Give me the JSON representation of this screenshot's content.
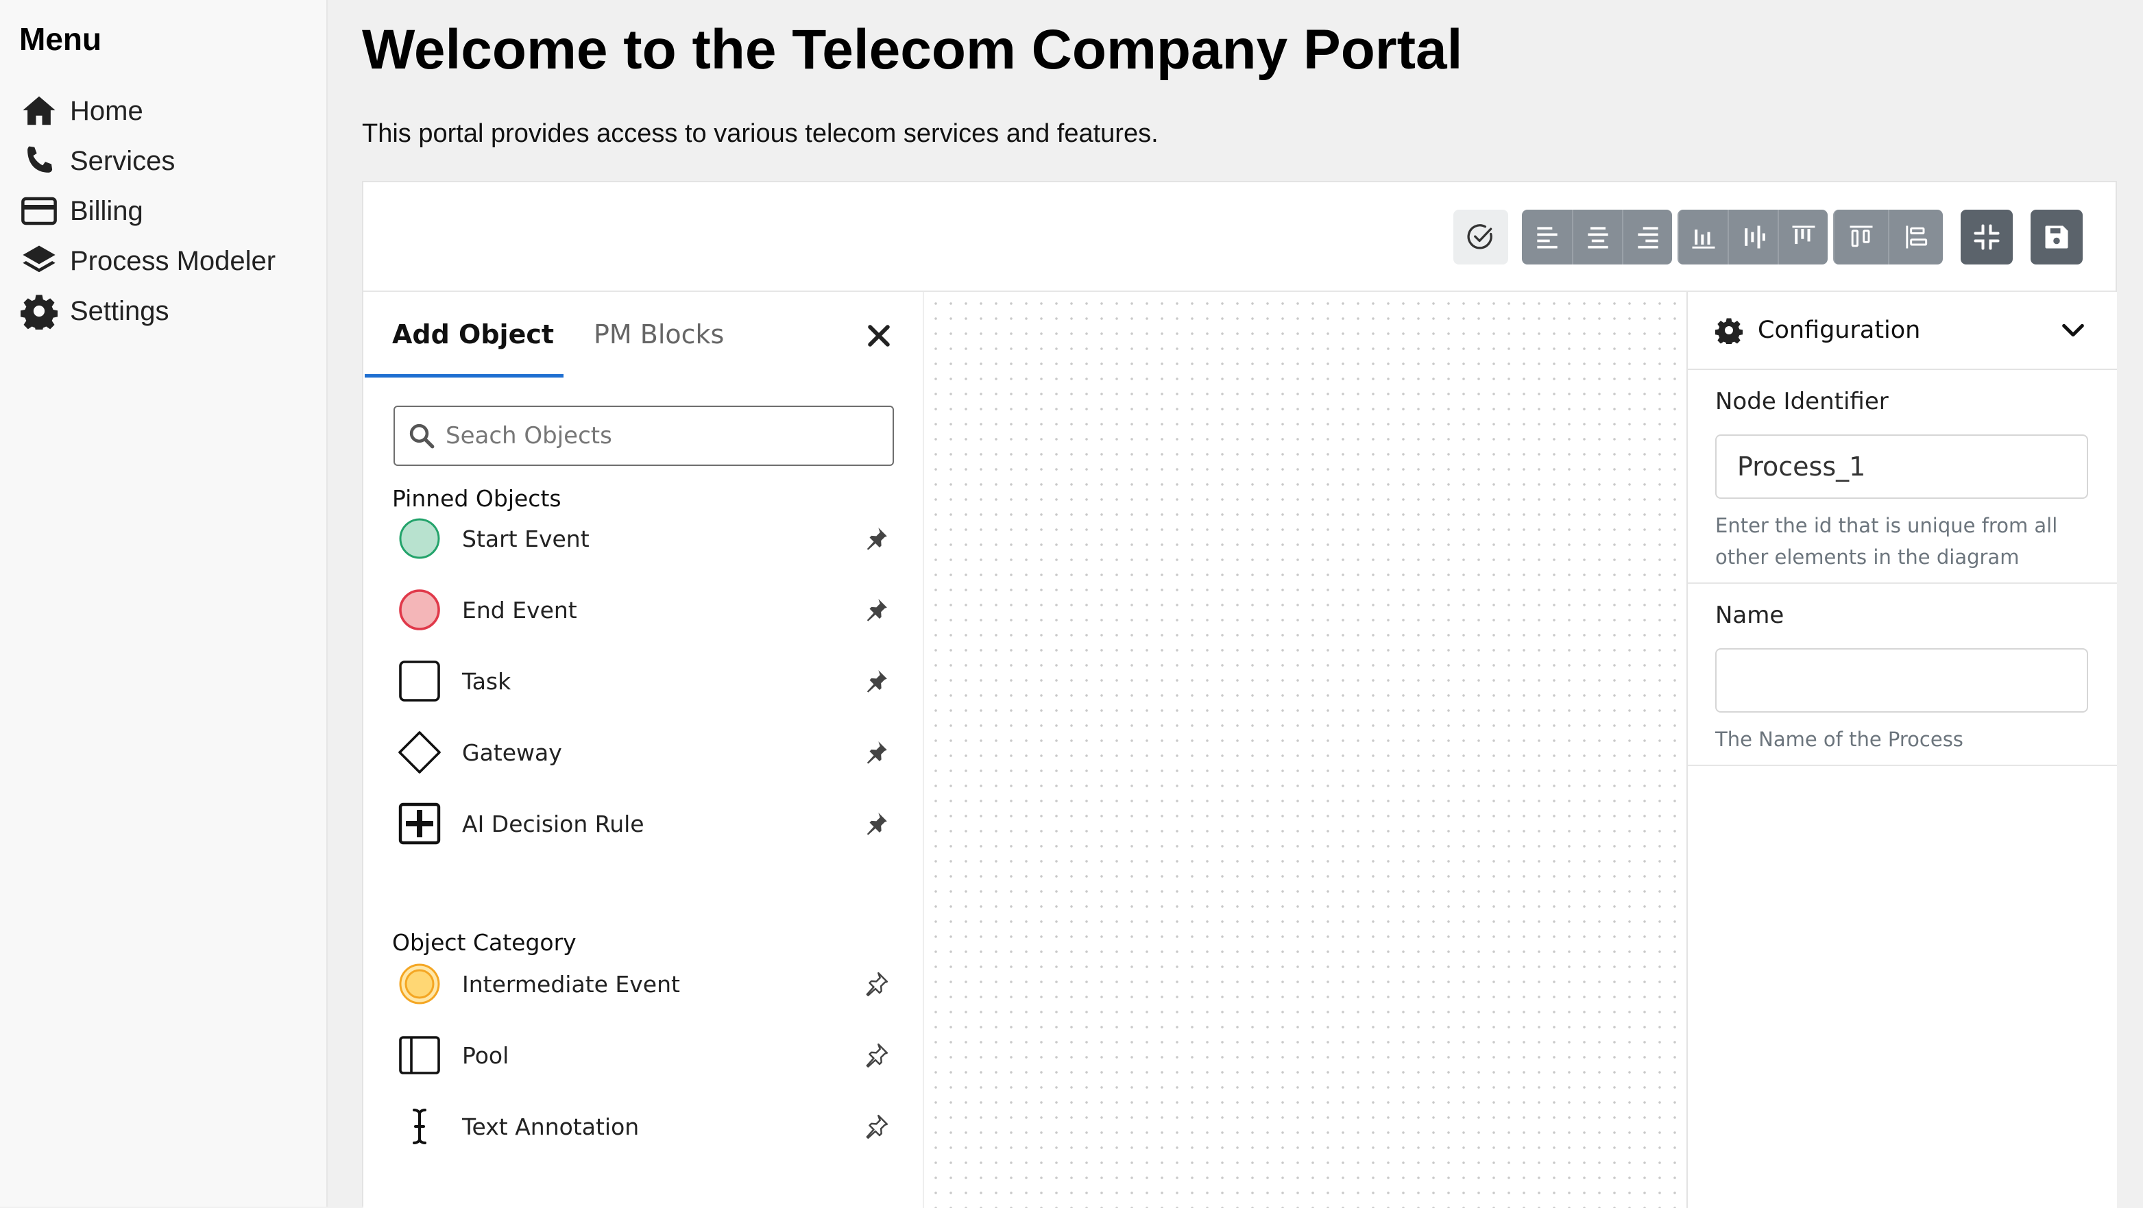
{
  "sidebar": {
    "title": "Menu",
    "items": [
      {
        "label": "Home",
        "icon": "home-icon"
      },
      {
        "label": "Services",
        "icon": "phone-icon"
      },
      {
        "label": "Billing",
        "icon": "credit-card-icon"
      },
      {
        "label": "Process Modeler",
        "icon": "layers-icon"
      },
      {
        "label": "Settings",
        "icon": "gear-icon"
      }
    ]
  },
  "header": {
    "title": "Welcome to the Telecom Company Portal",
    "description": "This portal provides access to various telecom services and features."
  },
  "toolbar": {
    "buttons": [
      "validate-icon",
      "align-left-icon",
      "align-center-icon",
      "align-right-icon",
      "align-bottom-icon",
      "align-middle-icon",
      "align-top-icon",
      "distribute-horizontal-icon",
      "distribute-vertical-icon",
      "compress-icon",
      "save-icon"
    ]
  },
  "left_panel": {
    "tabs": [
      "Add Object",
      "PM Blocks"
    ],
    "search_placeholder": "Seach Objects",
    "pinned_heading": "Pinned Objects",
    "pinned": [
      {
        "label": "Start Event",
        "icon": "start-event-icon"
      },
      {
        "label": "End Event",
        "icon": "end-event-icon"
      },
      {
        "label": "Task",
        "icon": "task-icon"
      },
      {
        "label": "Gateway",
        "icon": "gateway-icon"
      },
      {
        "label": "AI Decision Rule",
        "icon": "ai-decision-rule-icon"
      }
    ],
    "category_heading": "Object Category",
    "category": [
      {
        "label": "Intermediate Event",
        "icon": "intermediate-event-icon"
      },
      {
        "label": "Pool",
        "icon": "pool-icon"
      },
      {
        "label": "Text Annotation",
        "icon": "text-annotation-icon"
      }
    ]
  },
  "config": {
    "title": "Configuration",
    "node_id_label": "Node Identifier",
    "node_id_value": "Process_1",
    "node_id_help": "Enter the id that is unique from all other elements in the diagram",
    "name_label": "Name",
    "name_value": "",
    "name_help": "The Name of the Process"
  },
  "colors": {
    "start_event_fill": "#b8e2cf",
    "start_event_stroke": "#23a36b",
    "end_event_fill": "#f4b6b8",
    "end_event_stroke": "#e0394a",
    "intermediate_fill": "#ffd774",
    "intermediate_stroke": "#f4a623",
    "toolbar_gray": "#868e96",
    "toolbar_dark": "#5b636b",
    "tab_accent": "#1f6fd1"
  }
}
